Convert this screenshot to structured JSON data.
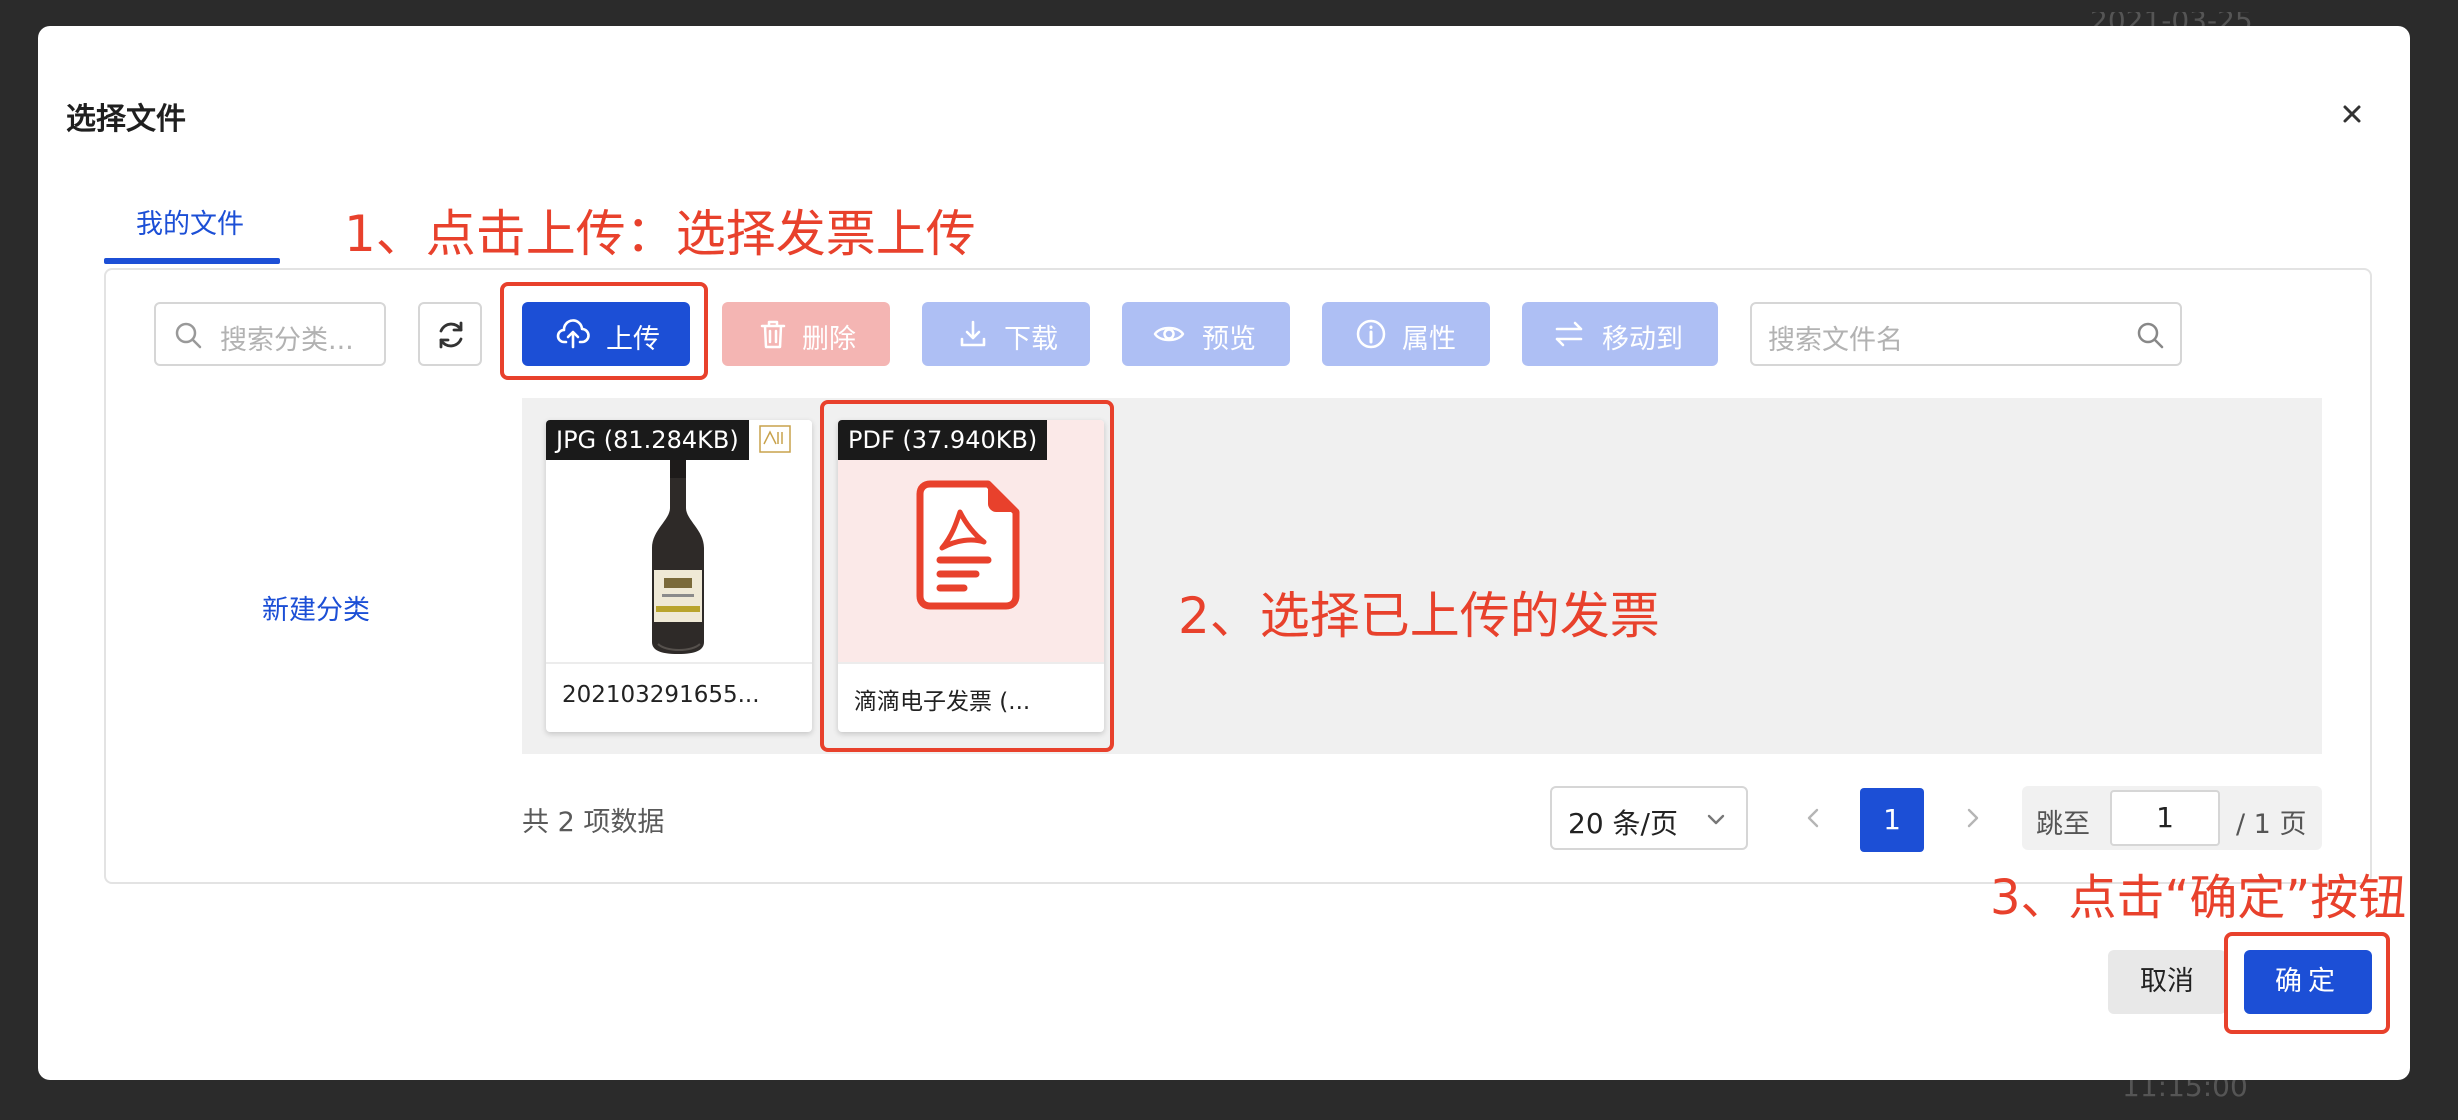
{
  "background": {
    "top_date_fragment": "2021-03-25",
    "bottom_time_fragment": "11:15:00"
  },
  "dialog": {
    "title": "选择文件",
    "close_icon": "close-icon"
  },
  "tabs": [
    {
      "label": "我的文件",
      "active": true
    }
  ],
  "toolbar": {
    "category_search_placeholder": "搜索分类...",
    "upload_label": "上传",
    "delete_label": "删除",
    "download_label": "下载",
    "preview_label": "预览",
    "properties_label": "属性",
    "move_label": "移动到",
    "file_search_placeholder": "搜索文件名"
  },
  "sidebar": {
    "new_category_label": "新建分类"
  },
  "files": [
    {
      "badge": "JPG (81.284KB)",
      "name": "202103291655...",
      "type": "jpg"
    },
    {
      "badge": "PDF (37.940KB)",
      "name": "滴滴电子发票 (...",
      "type": "pdf"
    }
  ],
  "pagination": {
    "total_text": "共 2 项数据",
    "page_size": "20 条/页",
    "current_page": "1",
    "jump_prefix": "跳至",
    "jump_value": "1",
    "jump_suffix": "/ 1 页"
  },
  "footer": {
    "cancel_label": "取消",
    "confirm_label": "确定"
  },
  "annotations": {
    "step1": "1、点击上传：选择发票上传",
    "step2": "2、选择已上传的发票",
    "step3": "3、点击“确定”按钮"
  },
  "colors": {
    "primary": "#1c4fd6",
    "annotation_red": "#e8412c",
    "disabled_blue": "#aebff4",
    "disabled_red": "#f4b5b3"
  }
}
